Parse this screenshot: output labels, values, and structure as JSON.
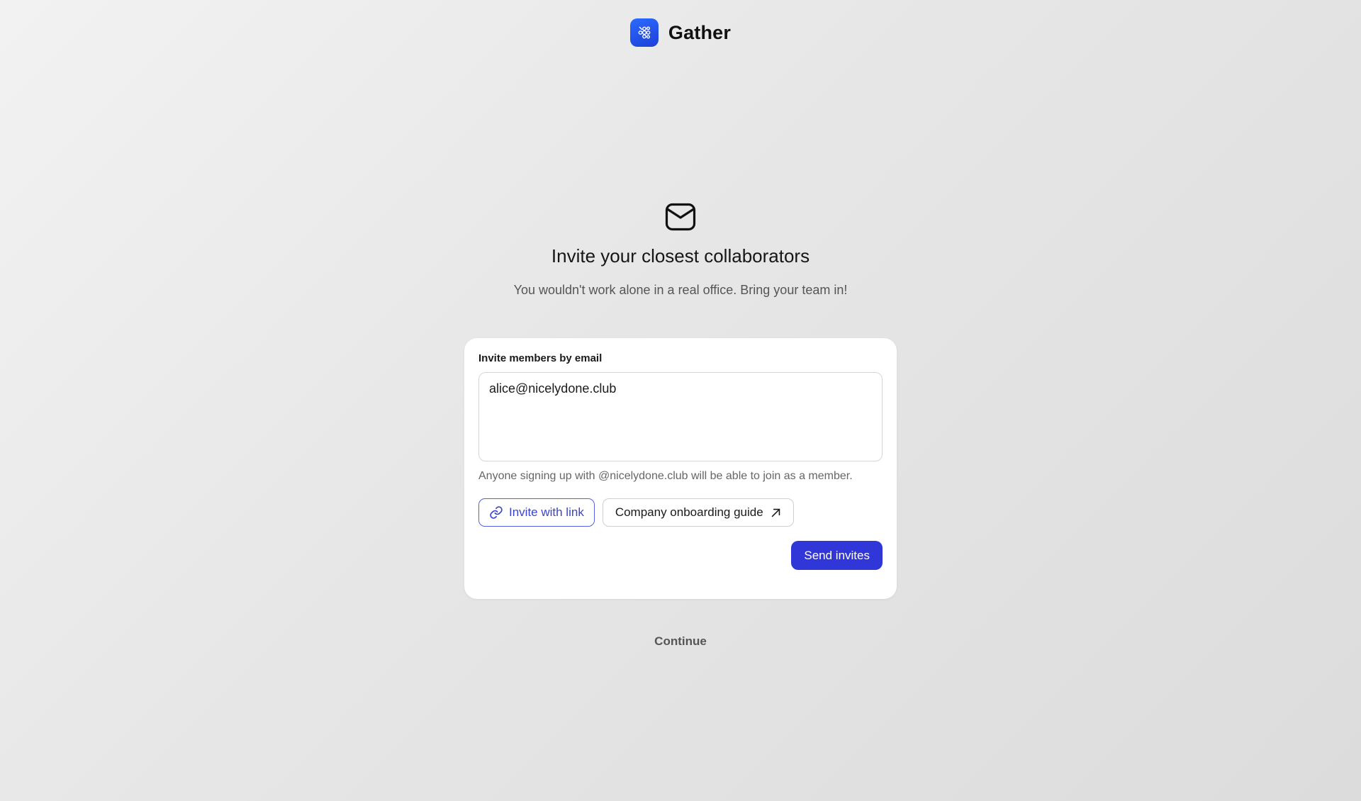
{
  "app": {
    "name": "Gather",
    "logo_icon": "gather-logo-icon",
    "brand_color": "#2554f0"
  },
  "hero": {
    "icon": "mail-icon",
    "title": "Invite your closest collaborators",
    "subtitle": "You wouldn't work alone in a real office. Bring your team in!"
  },
  "invite_card": {
    "label": "Invite members by email",
    "email_value": "alice@nicelydone.club",
    "helper_text": "Anyone signing up with @nicelydone.club will be able to join as a member.",
    "invite_link_button": {
      "label": "Invite with link",
      "icon": "link-icon"
    },
    "guide_button": {
      "label": "Company onboarding guide",
      "icon": "arrow-up-right-icon"
    },
    "send_button": {
      "label": "Send invites",
      "color": "#3136d9"
    }
  },
  "footer": {
    "continue_label": "Continue"
  }
}
